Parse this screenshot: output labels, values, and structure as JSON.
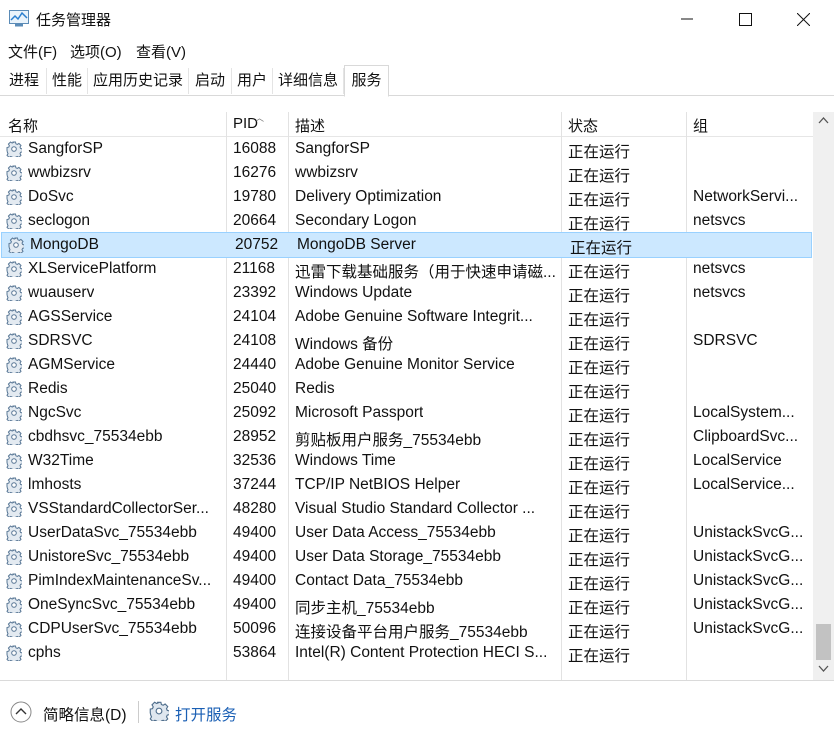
{
  "window": {
    "title": "任务管理器"
  },
  "menu": [
    "文件(F)",
    "选项(O)",
    "查看(V)"
  ],
  "tabs": [
    "进程",
    "性能",
    "应用历史记录",
    "启动",
    "用户",
    "详细信息",
    "服务"
  ],
  "active_tab": "服务",
  "columns": {
    "name": "名称",
    "pid": "PID",
    "desc": "描述",
    "status": "状态",
    "group": "组"
  },
  "services": [
    {
      "name": "SangforSP",
      "pid": "16088",
      "desc": "SangforSP",
      "status": "正在运行",
      "group": ""
    },
    {
      "name": "wwbizsrv",
      "pid": "16276",
      "desc": "wwbizsrv",
      "status": "正在运行",
      "group": ""
    },
    {
      "name": "DoSvc",
      "pid": "19780",
      "desc": "Delivery Optimization",
      "status": "正在运行",
      "group": "NetworkServi..."
    },
    {
      "name": "seclogon",
      "pid": "20664",
      "desc": "Secondary Logon",
      "status": "正在运行",
      "group": "netsvcs"
    },
    {
      "name": "MongoDB",
      "pid": "20752",
      "desc": "MongoDB Server",
      "status": "正在运行",
      "group": ""
    },
    {
      "name": "XLServicePlatform",
      "pid": "21168",
      "desc": "迅雷下载基础服务（用于快速申请磁...",
      "status": "正在运行",
      "group": "netsvcs"
    },
    {
      "name": "wuauserv",
      "pid": "23392",
      "desc": "Windows Update",
      "status": "正在运行",
      "group": "netsvcs"
    },
    {
      "name": "AGSService",
      "pid": "24104",
      "desc": "Adobe Genuine Software Integrit...",
      "status": "正在运行",
      "group": ""
    },
    {
      "name": "SDRSVC",
      "pid": "24108",
      "desc": "Windows 备份",
      "status": "正在运行",
      "group": "SDRSVC"
    },
    {
      "name": "AGMService",
      "pid": "24440",
      "desc": "Adobe Genuine Monitor Service",
      "status": "正在运行",
      "group": ""
    },
    {
      "name": "Redis",
      "pid": "25040",
      "desc": "Redis",
      "status": "正在运行",
      "group": ""
    },
    {
      "name": "NgcSvc",
      "pid": "25092",
      "desc": "Microsoft Passport",
      "status": "正在运行",
      "group": "LocalSystem..."
    },
    {
      "name": "cbdhsvc_75534ebb",
      "pid": "28952",
      "desc": "剪贴板用户服务_75534ebb",
      "status": "正在运行",
      "group": "ClipboardSvc..."
    },
    {
      "name": "W32Time",
      "pid": "32536",
      "desc": "Windows Time",
      "status": "正在运行",
      "group": "LocalService"
    },
    {
      "name": "lmhosts",
      "pid": "37244",
      "desc": "TCP/IP NetBIOS Helper",
      "status": "正在运行",
      "group": "LocalService..."
    },
    {
      "name": "VSStandardCollectorSer...",
      "pid": "48280",
      "desc": "Visual Studio Standard Collector ...",
      "status": "正在运行",
      "group": ""
    },
    {
      "name": "UserDataSvc_75534ebb",
      "pid": "49400",
      "desc": "User Data Access_75534ebb",
      "status": "正在运行",
      "group": "UnistackSvcG..."
    },
    {
      "name": "UnistoreSvc_75534ebb",
      "pid": "49400",
      "desc": "User Data Storage_75534ebb",
      "status": "正在运行",
      "group": "UnistackSvcG..."
    },
    {
      "name": "PimIndexMaintenanceSv...",
      "pid": "49400",
      "desc": "Contact Data_75534ebb",
      "status": "正在运行",
      "group": "UnistackSvcG..."
    },
    {
      "name": "OneSyncSvc_75534ebb",
      "pid": "49400",
      "desc": "同步主机_75534ebb",
      "status": "正在运行",
      "group": "UnistackSvcG..."
    },
    {
      "name": "CDPUserSvc_75534ebb",
      "pid": "50096",
      "desc": "连接设备平台用户服务_75534ebb",
      "status": "正在运行",
      "group": "UnistackSvcG..."
    },
    {
      "name": "cphs",
      "pid": "53864",
      "desc": "Intel(R) Content Protection HECI S...",
      "status": "正在运行",
      "group": ""
    }
  ],
  "selected_service": "MongoDB",
  "footer": {
    "brief_info": "简略信息(D)",
    "open_services": "打开服务"
  },
  "colors": {
    "selection": "#cce8ff",
    "selection_border": "#99d1ff",
    "link": "#1a5fb4"
  }
}
